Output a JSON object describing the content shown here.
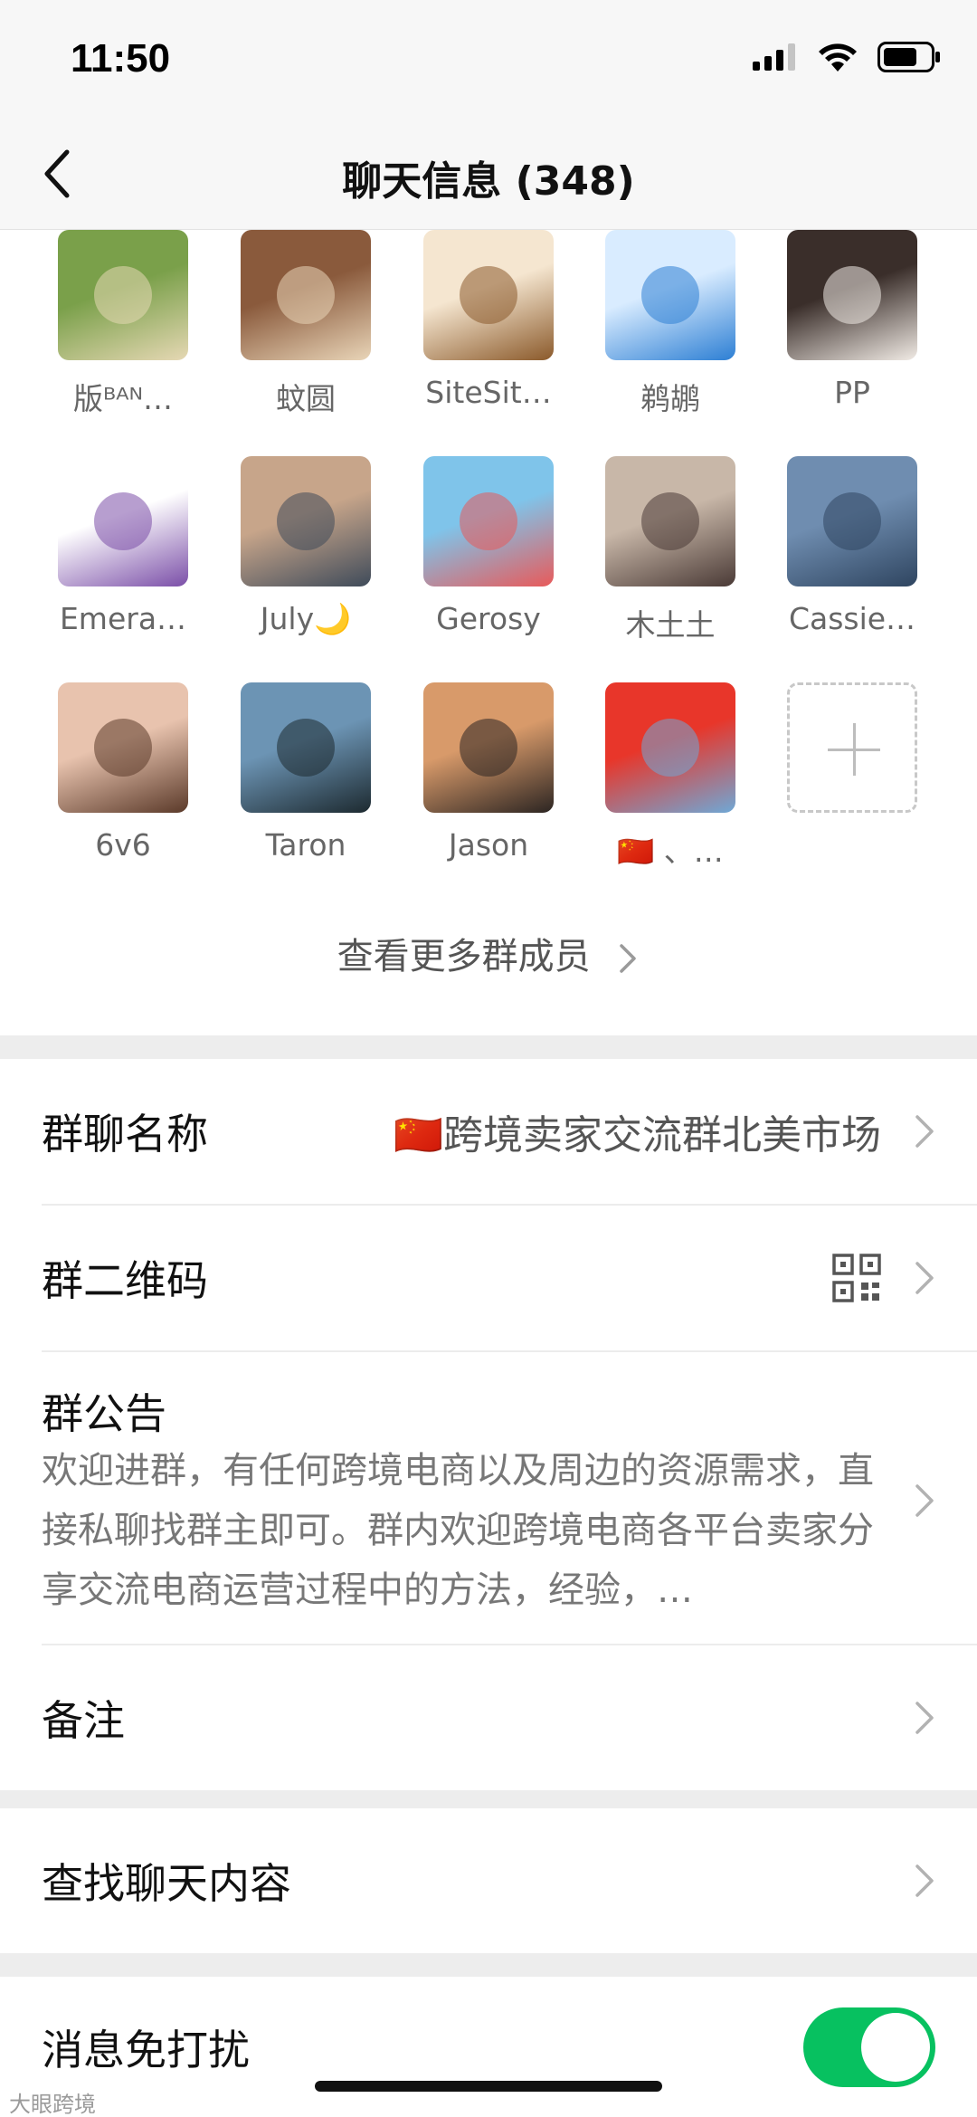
{
  "status_bar": {
    "time": "11:50"
  },
  "nav": {
    "title": "聊天信息 (348)"
  },
  "members": [
    {
      "name": "版ᴮᴬᴺ…",
      "avatar_colors": [
        "#7aa04a",
        "#e6d8b4"
      ]
    },
    {
      "name": "蚊圆",
      "avatar_colors": [
        "#8a5a3c",
        "#e9d5b8"
      ]
    },
    {
      "name": "SiteSit…",
      "avatar_colors": [
        "#f5e6d0",
        "#8b5a2b"
      ]
    },
    {
      "name": "鹈鹕",
      "avatar_colors": [
        "#d9ecff",
        "#2d7fd4"
      ]
    },
    {
      "name": "PP",
      "avatar_colors": [
        "#3a2e2a",
        "#f1ebe5"
      ]
    },
    {
      "name": "Emera…",
      "avatar_colors": [
        "#ffffff",
        "#7b4fa8"
      ]
    },
    {
      "name": "July🌙",
      "avatar_colors": [
        "#c7a58a",
        "#3f4b5a"
      ]
    },
    {
      "name": "Gerosy",
      "avatar_colors": [
        "#7fc4ea",
        "#e85a5a"
      ]
    },
    {
      "name": "木土土",
      "avatar_colors": [
        "#c8b7a8",
        "#4a3a36"
      ]
    },
    {
      "name": "Cassie…",
      "avatar_colors": [
        "#6f8db0",
        "#2f4560"
      ]
    },
    {
      "name": "6v6",
      "avatar_colors": [
        "#e8c3ae",
        "#5b3a2a"
      ]
    },
    {
      "name": "Taron",
      "avatar_colors": [
        "#6c94b4",
        "#1d2a30"
      ]
    },
    {
      "name": "Jason",
      "avatar_colors": [
        "#d89a6a",
        "#2c2522"
      ]
    },
    {
      "name": "🇨🇳 、…",
      "avatar_colors": [
        "#e8362a",
        "#6fa8d6"
      ]
    }
  ],
  "more_members_label": "查看更多群成员",
  "cells": {
    "group_name_label": "群聊名称",
    "group_name_value": "🇨🇳跨境卖家交流群北美市场",
    "qr_label": "群二维码",
    "notice_title": "群公告",
    "notice_text": "欢迎进群，有任何跨境电商以及周边的资源需求，直接私聊找群主即可。群内欢迎跨境电商各平台卖家分享交流电商运营过程中的方法，经验，…",
    "remark_label": "备注",
    "search_label": "查找聊天内容",
    "mute_label": "消息免打扰",
    "mute_on": true
  },
  "watermark": "大眼跨境",
  "colors": {
    "toggle_on": "#07c160",
    "chevron": "#b2b2b2"
  }
}
